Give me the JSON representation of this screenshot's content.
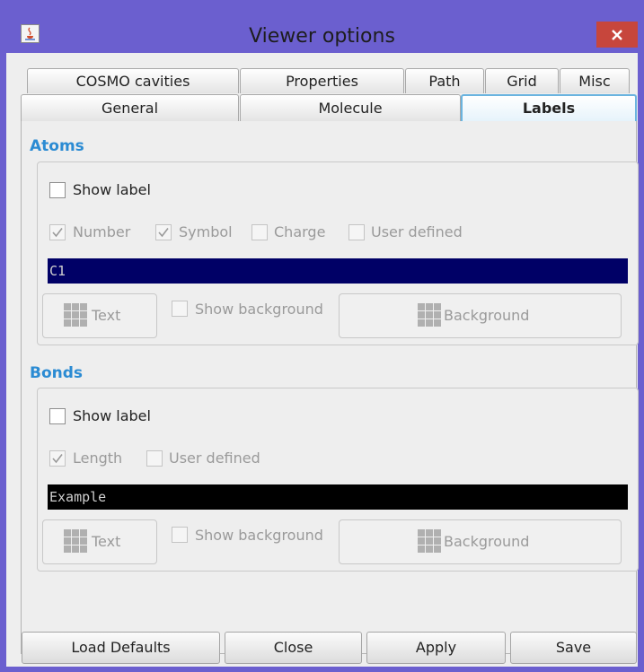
{
  "window": {
    "title": "Viewer options"
  },
  "tabs": {
    "row1": [
      "COSMO cavities",
      "Properties",
      "Path",
      "Grid",
      "Misc"
    ],
    "row2": [
      "General",
      "Molecule",
      "Labels"
    ],
    "selected": "Labels"
  },
  "atoms": {
    "title": "Atoms",
    "show_label": {
      "label": "Show label",
      "checked": false
    },
    "options": [
      {
        "label": "Number",
        "checked": true
      },
      {
        "label": "Symbol",
        "checked": true
      },
      {
        "label": "Charge",
        "checked": false
      },
      {
        "label": "User defined",
        "checked": false
      }
    ],
    "preview_text": "C1",
    "preview_color": "#000066",
    "text_button": "Text",
    "show_background": {
      "label": "Show background",
      "checked": false
    },
    "background_button": "Background"
  },
  "bonds": {
    "title": "Bonds",
    "show_label": {
      "label": "Show label",
      "checked": false
    },
    "options": [
      {
        "label": "Length",
        "checked": true
      },
      {
        "label": "User defined",
        "checked": false
      }
    ],
    "preview_text": "Example",
    "preview_color": "#000000",
    "text_button": "Text",
    "show_background": {
      "label": "Show background",
      "checked": false
    },
    "background_button": "Background"
  },
  "footer": {
    "load_defaults": "Load Defaults",
    "close": "Close",
    "apply": "Apply",
    "save": "Save"
  },
  "colors": {
    "titlebar": "#6b5fcf",
    "close_button": "#c7463c",
    "section_title": "#2b8bd3",
    "selected_tab_border": "#6bb4df"
  },
  "icons": {
    "app": "java-cup-icon",
    "close": "close-icon",
    "color_swatch": "grid-icon",
    "check": "checkmark-icon"
  }
}
